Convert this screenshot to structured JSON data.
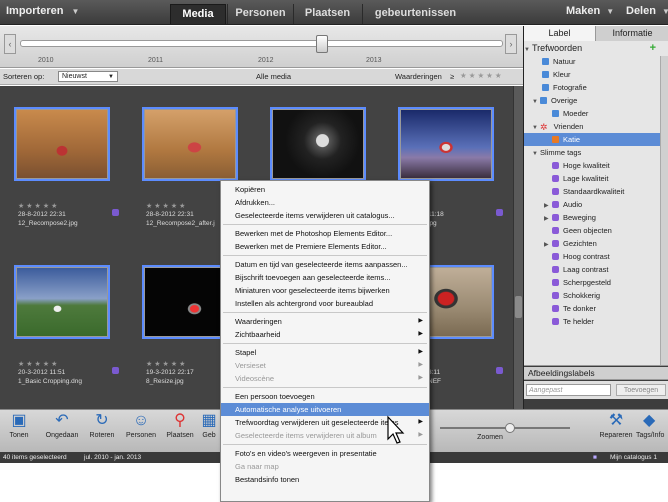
{
  "topbar": {
    "importeren": "Importeren",
    "tabs": [
      "Media",
      "Personen",
      "Plaatsen",
      "gebeurtenissen"
    ],
    "maken": "Maken",
    "delen": "Delen"
  },
  "timeline": {
    "years": [
      "2010",
      "2011",
      "2012",
      "2013"
    ]
  },
  "filter": {
    "sort_label": "Sorteren op:",
    "sort_value": "Nieuwst",
    "all_media": "Alle media",
    "ratings": "Waarderingen",
    "rating_op": "≥"
  },
  "photos": [
    {
      "date": "28-8-2012 22:31",
      "name": "12_Recompose2.jpg"
    },
    {
      "date": "28-8-2012 22:31",
      "name": "12_Recompose2_after.j"
    },
    {
      "date": "",
      "name": ""
    },
    {
      "date": "11:18",
      "name": "jpg"
    },
    {
      "date": "20-3-2012 11:51",
      "name": "1_Basic Cropping.dng"
    },
    {
      "date": "19-3-2012 22:17",
      "name": "8_Resize.jpg"
    },
    {
      "date": "",
      "name": ""
    },
    {
      "date": "3:11",
      "name": "NEF"
    }
  ],
  "rpanel": {
    "tab_label": "Label",
    "tab_info": "Informatie",
    "trefwoorden": "Trefwoorden",
    "items": [
      "Natuur",
      "Kleur",
      "Fotografie",
      "Overige",
      "Moeder",
      "Vrienden",
      "Katie",
      "Slimme tags",
      "Hoge kwaliteit",
      "Lage kwaliteit",
      "Standaardkwaliteit",
      "Audio",
      "Beweging",
      "Geen objecten",
      "Gezichten",
      "Hoog contrast",
      "Laag contrast",
      "Scherpgesteld",
      "Schokkerig",
      "Te donker",
      "Te helder"
    ],
    "afbeeldingslabels": "Afbeeldingslabels",
    "aangepast": "Aangepast",
    "toevoegen": "Toevoegen"
  },
  "bottom": {
    "tonen": "Tonen",
    "ongedaan": "Ongedaan",
    "roteren": "Roteren",
    "personen": "Personen",
    "plaatsen": "Plaatsen",
    "geb": "Geb",
    "zoomen": "Zoomen",
    "repareren": "Repareren",
    "tags": "Tags/Info"
  },
  "status": {
    "selected": "40 items geselecteerd",
    "range": "jul. 2010 - jan. 2013",
    "catalog": "Mijn catalogus 1"
  },
  "menu": [
    {
      "label": "Kopiëren"
    },
    {
      "label": "Afdrukken..."
    },
    {
      "label": "Geselecteerde items verwijderen uit catalogus..."
    },
    {
      "label": "Bewerken met de Photoshop Elements Editor..."
    },
    {
      "label": "Bewerken met de Premiere Elements Editor..."
    },
    {
      "label": "Datum en tijd van geselecteerde items aanpassen..."
    },
    {
      "label": "Bijschrift toevoegen aan geselecteerde items..."
    },
    {
      "label": "Miniaturen voor geselecteerde items bijwerken"
    },
    {
      "label": "Instellen als achtergrond voor bureaublad"
    },
    {
      "label": "Waarderingen"
    },
    {
      "label": "Zichtbaarheid"
    },
    {
      "label": "Stapel"
    },
    {
      "label": "Versieset"
    },
    {
      "label": "Videoscène"
    },
    {
      "label": "Een persoon toevoegen"
    },
    {
      "label": "Automatische analyse uitvoeren"
    },
    {
      "label": "Trefwoordtag verwijderen uit geselecteerde items"
    },
    {
      "label": "Geselecteerde items verwijderen uit album"
    },
    {
      "label": "Foto's en video's weergeven in presentatie"
    },
    {
      "label": "Ga naar map"
    },
    {
      "label": "Bestandsinfo tonen"
    }
  ],
  "colors": {
    "accent": "#5c8cd6",
    "bg_dark": "#434343"
  }
}
